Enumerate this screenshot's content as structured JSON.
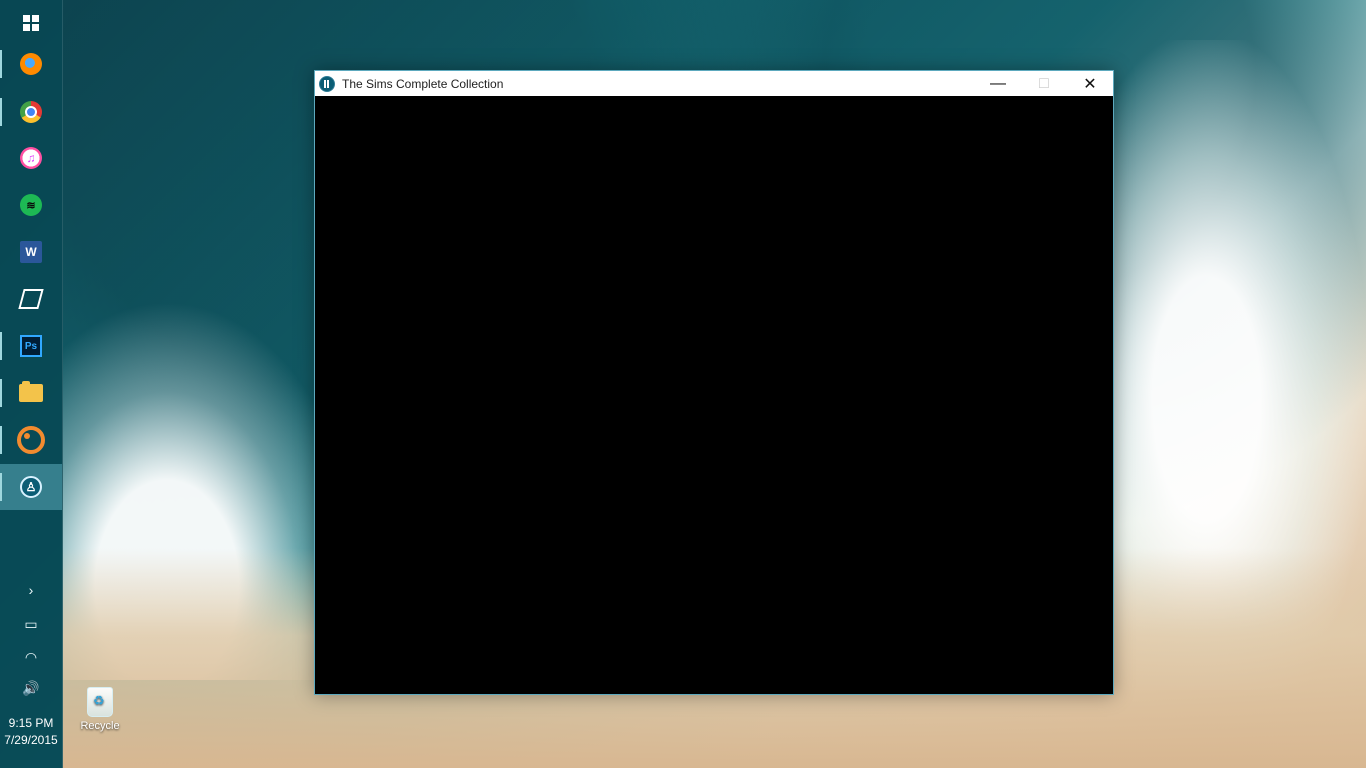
{
  "desktop": {
    "recycle_label": "Recycle"
  },
  "taskbar": {
    "items": [
      {
        "name": "start-button",
        "label": "",
        "icon": "windows-logo-icon"
      },
      {
        "name": "firefox-button",
        "label": "",
        "icon": "firefox-icon"
      },
      {
        "name": "chrome-button",
        "label": "",
        "icon": "chrome-icon"
      },
      {
        "name": "itunes-button",
        "label": "",
        "icon": "itunes-icon"
      },
      {
        "name": "spotify-button",
        "label": "",
        "icon": "spotify-icon"
      },
      {
        "name": "word-button",
        "label": "W",
        "icon": "word-icon"
      },
      {
        "name": "app-button",
        "label": "",
        "icon": "stripes-icon"
      },
      {
        "name": "photoshop-button",
        "label": "Ps",
        "icon": "photoshop-icon"
      },
      {
        "name": "file-explorer-button",
        "label": "",
        "icon": "folder-icon"
      },
      {
        "name": "origin-button",
        "label": "",
        "icon": "origin-icon"
      },
      {
        "name": "sims-button",
        "label": "",
        "icon": "sims-icon"
      }
    ],
    "tray": {
      "expand": "›",
      "battery": "▭",
      "wifi": "◠",
      "volume": "🔊"
    },
    "clock": {
      "time": "9:15 PM",
      "date": "7/29/2015"
    }
  },
  "window": {
    "title": "The Sims Complete Collection",
    "buttons": {
      "minimize": "—",
      "maximize": "□",
      "close": "✕"
    }
  }
}
